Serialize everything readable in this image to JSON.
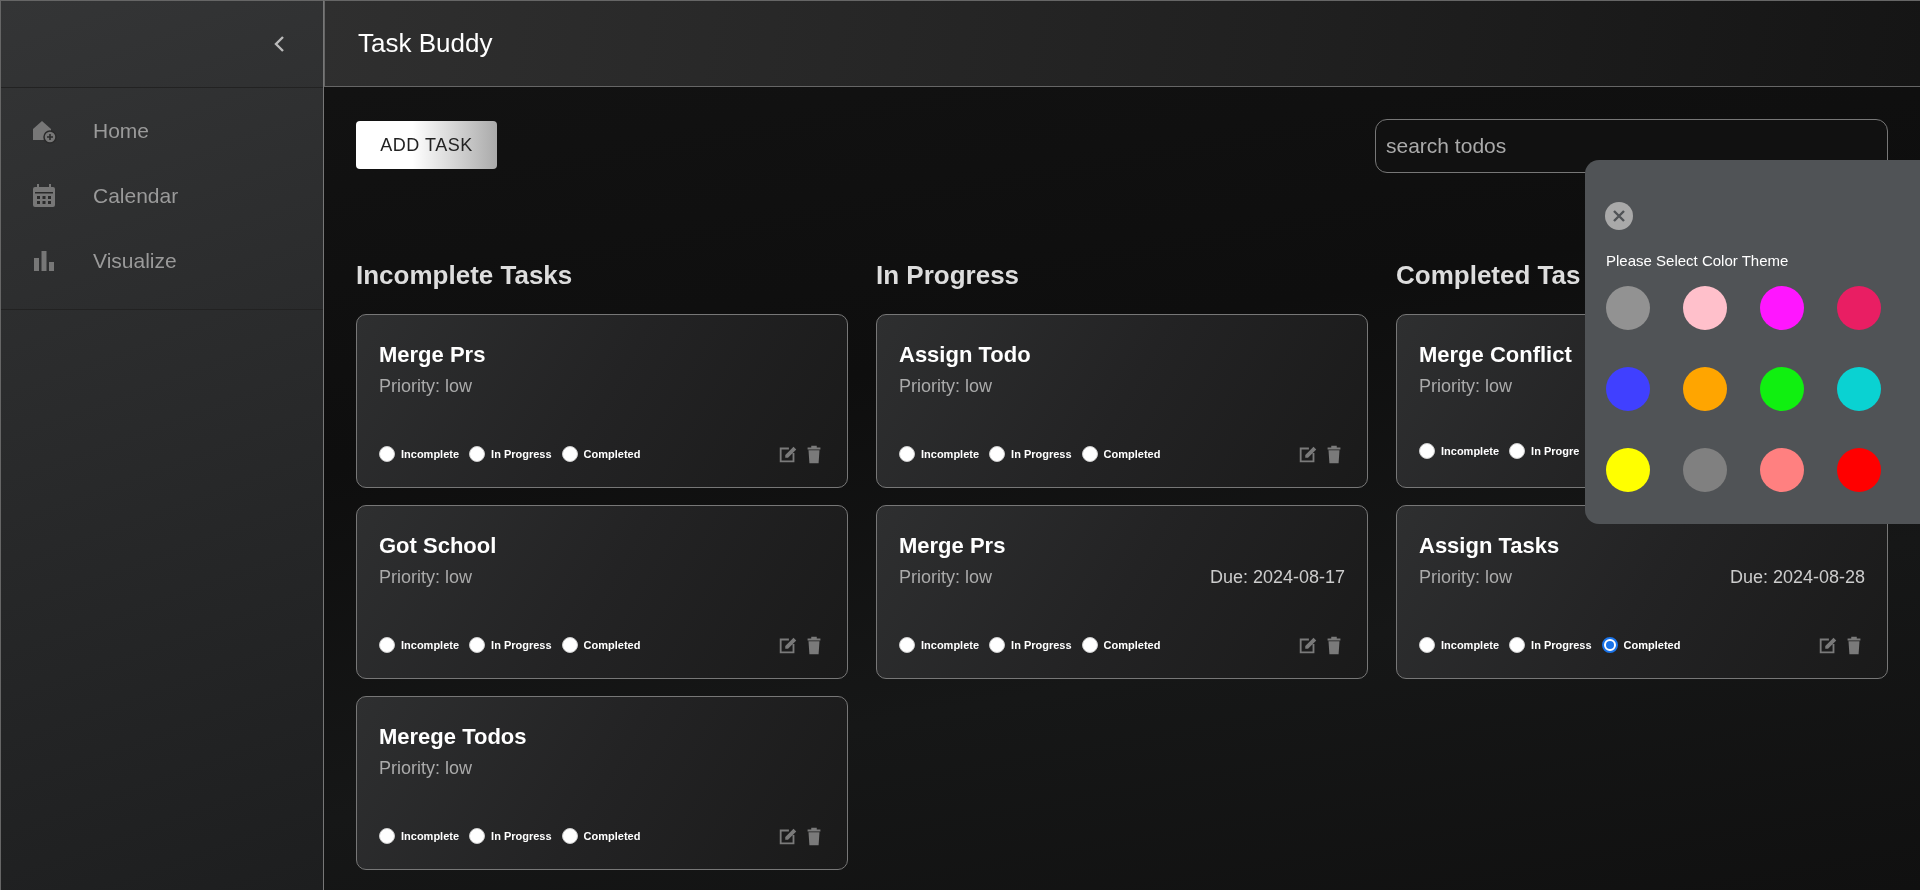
{
  "sidebar": {
    "items": [
      {
        "label": "Home"
      },
      {
        "label": "Calendar"
      },
      {
        "label": "Visualize"
      }
    ]
  },
  "header": {
    "title": "Task Buddy"
  },
  "toolbar": {
    "add_button": "ADD TASK",
    "search": {
      "placeholder": "search todos"
    }
  },
  "columns": [
    {
      "title": "Incomplete Tasks",
      "cards": [
        {
          "title": "Merge Prs",
          "priority": "Priority: low",
          "actions": true,
          "statuses": [
            {
              "label": "Incomplete",
              "selected": false
            },
            {
              "label": "In Progress",
              "selected": false
            },
            {
              "label": "Completed",
              "selected": false
            }
          ]
        },
        {
          "title": "Got School",
          "priority": "Priority: low",
          "actions": true,
          "statuses": [
            {
              "label": "Incomplete",
              "selected": false
            },
            {
              "label": "In Progress",
              "selected": false
            },
            {
              "label": "Completed",
              "selected": false
            }
          ]
        },
        {
          "title": "Merege Todos",
          "priority": "Priority: low",
          "actions": true,
          "statuses": [
            {
              "label": "Incomplete",
              "selected": false
            },
            {
              "label": "In Progress",
              "selected": false
            },
            {
              "label": "Completed",
              "selected": false
            }
          ]
        }
      ]
    },
    {
      "title": "In Progress",
      "cards": [
        {
          "title": "Assign Todo",
          "priority": "Priority: low",
          "actions": true,
          "statuses": [
            {
              "label": "Incomplete",
              "selected": false
            },
            {
              "label": "In Progress",
              "selected": false
            },
            {
              "label": "Completed",
              "selected": false
            }
          ]
        },
        {
          "title": "Merge Prs",
          "priority": "Priority: low",
          "due": "Due: 2024-08-17",
          "actions": true,
          "statuses": [
            {
              "label": "Incomplete",
              "selected": false
            },
            {
              "label": "In Progress",
              "selected": false
            },
            {
              "label": "Completed",
              "selected": false
            }
          ]
        }
      ]
    },
    {
      "title": "Completed Tas",
      "cards": [
        {
          "title": "Merge Conflict",
          "priority": "Priority: low",
          "actions": false,
          "statuses": [
            {
              "label": "Incomplete",
              "selected": false
            },
            {
              "label": "In Progre",
              "selected": false
            }
          ]
        },
        {
          "title": "Assign Tasks",
          "priority": "Priority: low",
          "due": "Due: 2024-08-28",
          "actions": true,
          "statuses": [
            {
              "label": "Incomplete",
              "selected": false
            },
            {
              "label": "In Progress",
              "selected": false
            },
            {
              "label": "Completed",
              "selected": true
            }
          ]
        }
      ]
    }
  ],
  "theme_popup": {
    "title": "Please Select Color Theme",
    "colors": [
      {
        "color": "#929292"
      },
      {
        "color": "#ffc0cb"
      },
      {
        "color": "#ff16ff"
      },
      {
        "color": "#e91e63"
      },
      {
        "color": "#4040ff"
      },
      {
        "color": "#ffa500"
      },
      {
        "color": "#10f010"
      },
      {
        "color": "#0ad2d2"
      },
      {
        "color": "#ffff00"
      },
      {
        "color": "#808080"
      },
      {
        "color": "#ff8080"
      },
      {
        "color": "#ff0000"
      }
    ]
  }
}
